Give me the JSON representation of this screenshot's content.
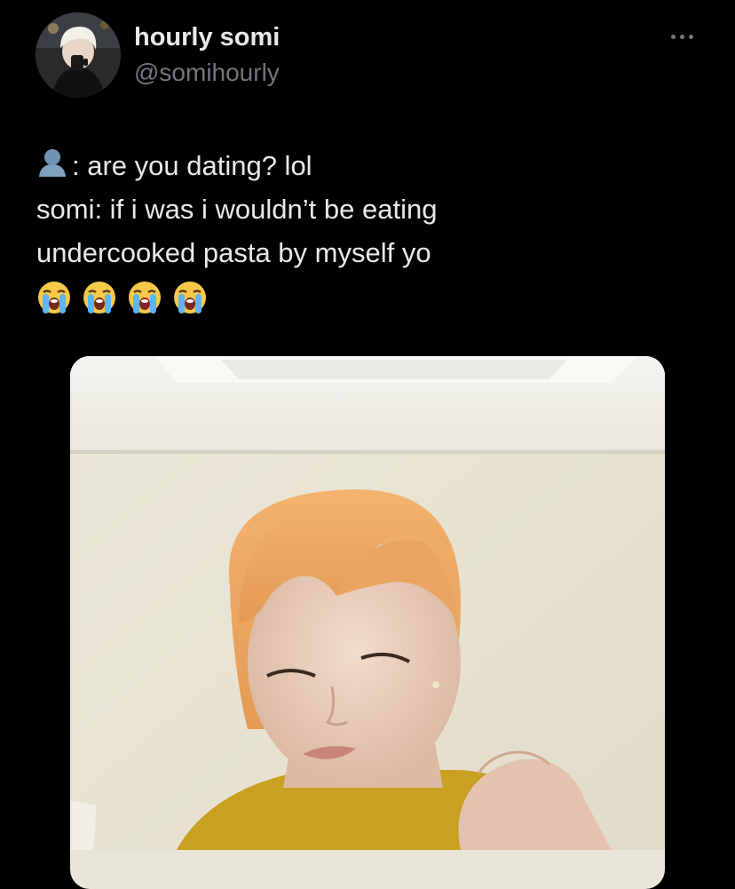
{
  "author": {
    "display_name": "hourly somi",
    "handle": "@somihourly",
    "avatar_icon": "profile-avatar"
  },
  "menu": {
    "more_icon": "more-dots-icon"
  },
  "tweet": {
    "line1_text": ": are you dating? lol",
    "line1_icon": "bust-in-silhouette-icon",
    "line2_text": "somi: if i was i wouldn’t be eating",
    "line3_text": "undercooked pasta by myself yo",
    "emoji": [
      "loudly-crying-face-icon",
      "loudly-crying-face-icon",
      "loudly-crying-face-icon",
      "loudly-crying-face-icon"
    ]
  },
  "media": {
    "type": "photo"
  },
  "colors": {
    "background": "#000000",
    "primary_text": "#e7e9ea",
    "secondary_text": "#71767b"
  }
}
